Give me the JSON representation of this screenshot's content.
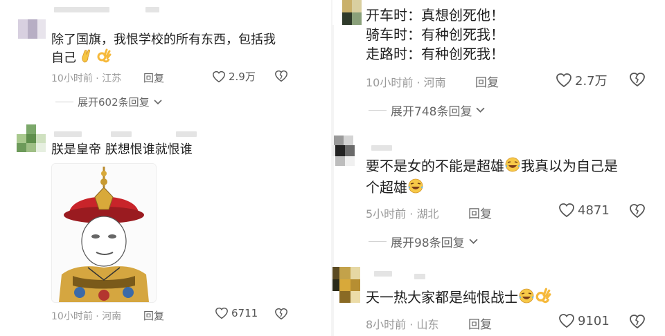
{
  "left": {
    "c1": {
      "text_line1": "除了国旗，我恨学校的所有东西，包括我",
      "text_line2": "自己",
      "time": "10小时前",
      "location": "江苏",
      "reply_label": "回复",
      "likes": "2.9万",
      "expand": "展开602条回复"
    },
    "c2": {
      "text": "朕是皇帝 朕想恨谁就恨谁",
      "time": "10小时前",
      "location": "河南",
      "reply_label": "回复",
      "likes": "6711"
    }
  },
  "right": {
    "c1": {
      "line1": "开车时：真想创死他！",
      "line2": "骑车时：有种创死我！",
      "line3": "走路时：有种创死我！",
      "time": "10小时前",
      "location": "河南",
      "reply_label": "回复",
      "likes": "2.7万",
      "expand": "展开748条回复"
    },
    "c2": {
      "text_line1": "要不是女的不能是超雄",
      "text_line1b": "我真以为自己是",
      "text_line2": "个超雄",
      "time": "5小时前",
      "location": "湖北",
      "reply_label": "回复",
      "likes": "4871",
      "expand": "展开98条回复"
    },
    "c3": {
      "text": "天一热大家都是纯恨战士",
      "time": "8小时前",
      "location": "山东",
      "reply_label": "回复",
      "likes": "9101"
    }
  },
  "meta_separator": "·",
  "colors": {
    "text": "#1f1f1f",
    "meta": "#9a9a9a",
    "reply": "#666666",
    "divider": "#f4f4f4"
  }
}
